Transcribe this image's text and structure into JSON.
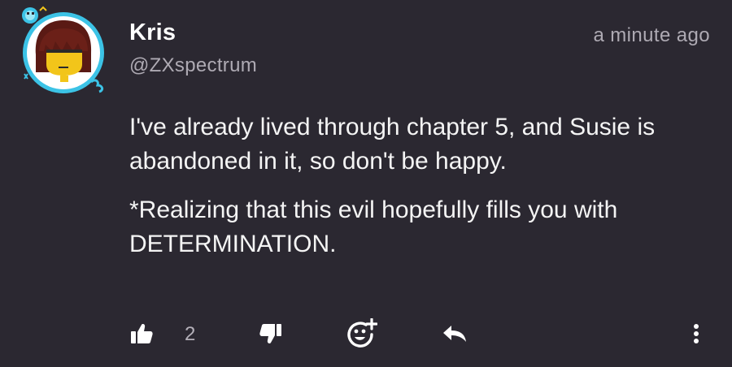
{
  "post": {
    "author": {
      "display_name": "Kris",
      "handle": "@ZXspectrum"
    },
    "timestamp": "a minute ago",
    "paragraphs": [
      "I've already lived through chapter 5, and Susie is abandoned in it, so don't be happy.",
      "*Realizing that this evil hopefully fills you with DETERMINATION."
    ]
  },
  "actions": {
    "like_count": "2",
    "icons": [
      "thumbs-up-icon",
      "thumbs-down-icon",
      "add-reaction-icon",
      "reply-icon",
      "more-vertical-icon"
    ]
  },
  "colors": {
    "background": "#2b2831",
    "text_primary": "#ffffff",
    "text_secondary": "#aeaab3",
    "avatar_ring": "#3cc3e6",
    "avatar_hair": "#5a1a14",
    "avatar_face": "#f2c51a"
  }
}
